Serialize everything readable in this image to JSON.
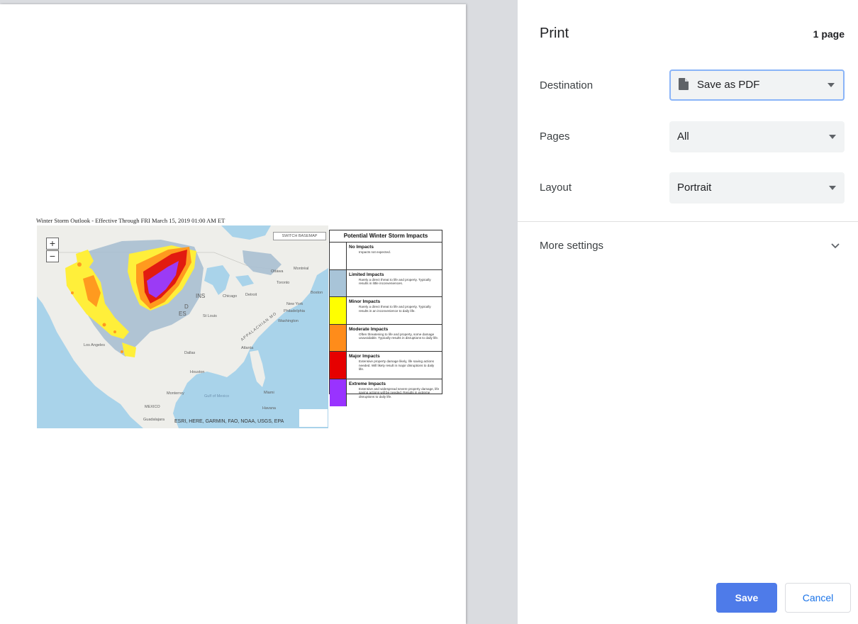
{
  "print_panel": {
    "title": "Print",
    "page_count": "1 page",
    "destination": {
      "label": "Destination",
      "value": "Save as PDF",
      "icon": "file-icon"
    },
    "pages": {
      "label": "Pages",
      "value": "All"
    },
    "layout": {
      "label": "Layout",
      "value": "Portrait"
    },
    "more_settings_label": "More settings",
    "save_label": "Save",
    "cancel_label": "Cancel",
    "colors": {
      "save_button": "#4e7be9",
      "cancel_text": "#1a73e8",
      "focus_border": "#8ab4f8"
    }
  },
  "preview": {
    "document_title": "Winter Storm Outlook - Effective Through FRI March 15, 2019 01:00 AM ET",
    "map": {
      "switch_basemap_label": "SWITCH BASEMAP",
      "zoom_in": "+",
      "zoom_out": "−",
      "attribution": "ESRI, HERE, GARMIN, FAO, NOAA, USGS, EPA",
      "place_labels": {
        "ottawa": "Ottawa",
        "montreal": "Montréal",
        "toronto": "Toronto",
        "boston": "Boston",
        "chicago": "Chicago",
        "detroit": "Detroit",
        "new_york": "New York",
        "philadelphia": "Philadelphia",
        "washington": "Washington",
        "st_louis": "St Louis",
        "atlanta": "Atlanta",
        "dallas": "Dallas",
        "houston": "Houston",
        "los_angeles": "Los Angeles",
        "monterrey": "Monterrey",
        "miami": "Miami",
        "havana": "Havana",
        "mexico": "MEXICO",
        "guadalajara": "Guadalajara",
        "gulf_of_mexico": "Gulf of Mexico",
        "appalachian": "APPALACHIAN MO",
        "ins": "INS",
        "states_d": "D",
        "states_es": "ES"
      }
    },
    "legend": {
      "title": "Potential Winter Storm Impacts",
      "items": [
        {
          "name": "No Impacts",
          "desc": "Impacts not expected.",
          "color": "#ffffff"
        },
        {
          "name": "Limited Impacts",
          "desc": "Rarely a direct threat to life and property. Typically results in little inconveniences.",
          "color": "#a8c4d8"
        },
        {
          "name": "Minor Impacts",
          "desc": "Rarely a direct threat to life and property. Typically results in an inconvenience to daily life.",
          "color": "#ffff00"
        },
        {
          "name": "Moderate Impacts",
          "desc": "Often threatening to life and property, some damage unavoidable. Typically results in disruptions to daily life.",
          "color": "#ff8c1a"
        },
        {
          "name": "Major Impacts",
          "desc": "Extensive property damage likely, life saving actions needed. Will likely result in major disruptions to daily life.",
          "color": "#e60000"
        },
        {
          "name": "Extreme Impacts",
          "desc": "Extensive and widespread severe property damage, life saving actions will be needed. Results in extreme disruptions to daily life.",
          "color": "#9933ff"
        }
      ]
    }
  }
}
